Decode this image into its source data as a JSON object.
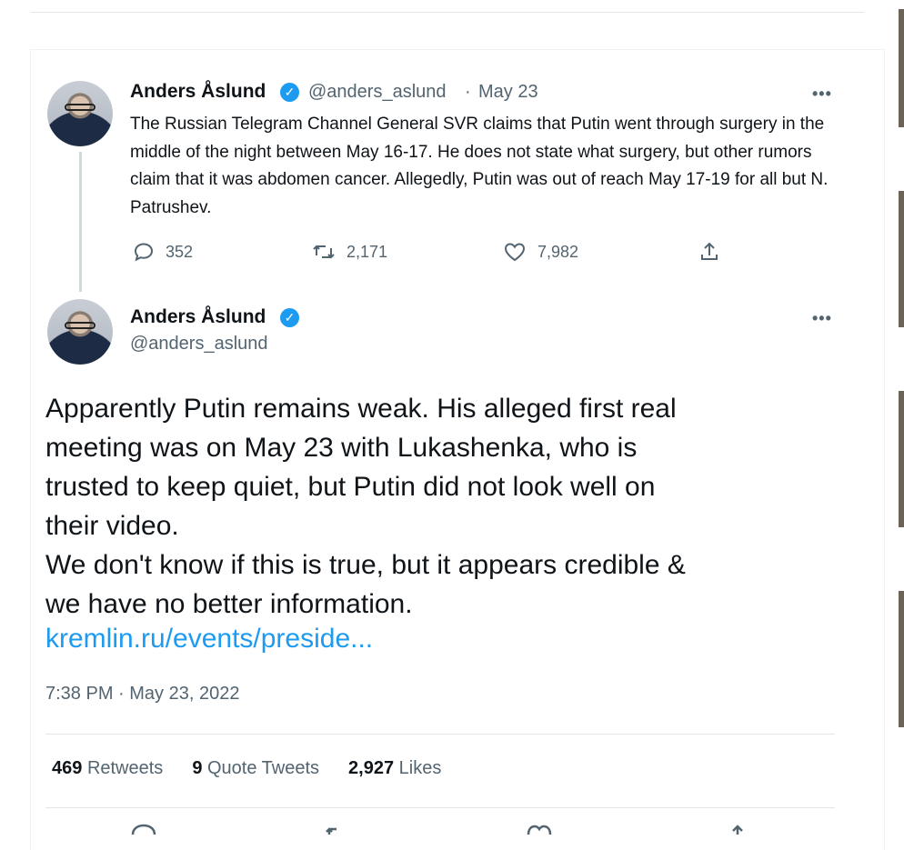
{
  "quoted_tweet": {
    "author_name": "Anders Åslund",
    "handle": "@anders_aslund",
    "separator": "·",
    "date": "May 23",
    "more": "•••",
    "text": "The Russian Telegram Channel General SVR claims that Putin went through surgery in the middle of the night between May 16-17. He does not state what surgery, but other rumors claim that it was abdomen cancer. Allegedly, Putin was out of reach May 17-19 for all but N. Patrushev.",
    "replies": "352",
    "retweets": "2,171",
    "likes": "7,982"
  },
  "main_tweet": {
    "author_name": "Anders Åslund",
    "handle": "@anders_aslund",
    "more": "•••",
    "text_lines": [
      "Apparently Putin remains weak. His alleged first real",
      "meeting was on May 23 with Lukashenka, who is",
      "trusted to keep quiet, but Putin did not look well on",
      "their video.",
      "We don't know if this is true, but it appears credible &",
      "we have no better information."
    ],
    "link": "kremlin.ru/events/preside...",
    "timestamp": "7:38 PM · May 23, 2022",
    "stats": {
      "retweets_count": "469",
      "retweets_label": "Retweets",
      "quote_count": "9",
      "quote_label": "Quote Tweets",
      "likes_count": "2,927",
      "likes_label": "Likes"
    }
  },
  "colors": {
    "accent": "#1d9bf0",
    "muted": "#536471",
    "text": "#0f1419"
  }
}
